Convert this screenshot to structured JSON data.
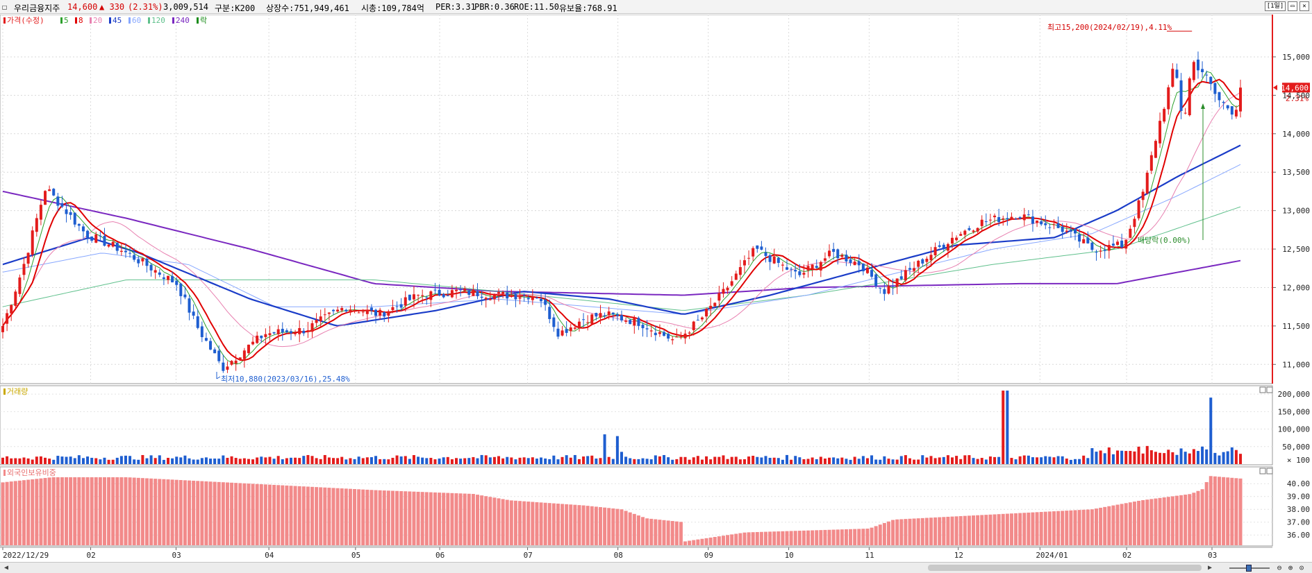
{
  "header": {
    "stock_name": "우리금융지주",
    "price": "14,600",
    "change": "▲ 330",
    "change_pct": "(2.31%)",
    "volume": "3,009,514",
    "category": "구분:K200",
    "shares": "상장수:751,949,461",
    "market_cap": "시총:109,784억",
    "per": "PER:3.31",
    "pbr": "PBR:0.36",
    "roe": "ROE:11.50",
    "reserve": "유보율:768.91",
    "period_button": "[1일]"
  },
  "legend": {
    "price_label": "가격(수정)",
    "ma_items": [
      {
        "label": "5",
        "color": "#2ca02c"
      },
      {
        "label": "8",
        "color": "#e00000"
      },
      {
        "label": "20",
        "color": "#e880b0"
      },
      {
        "label": "45",
        "color": "#1a3cc8"
      },
      {
        "label": "60",
        "color": "#88a8ff"
      },
      {
        "label": "120",
        "color": "#5fc08c"
      },
      {
        "label": "240",
        "color": "#7a28c0"
      }
    ],
    "ex_label": "락",
    "volume_label": "거래량",
    "foreign_label": "외국인보유비중"
  },
  "annotations": {
    "high_label": "최고15,200(2024/02/19),4.11%",
    "low_label": "최저10,880(2023/03/16),25.48%",
    "dividend_label": "배당락(0.00%)",
    "current_price": "14,600",
    "current_pct": "2.31%"
  },
  "colors": {
    "up": "#e31c1c",
    "down": "#1e5ed0",
    "foreign_bar": "#f28a8a",
    "price_tag": "#e31c1c"
  },
  "chart_data": [
    {
      "type": "candlestick",
      "title": "",
      "x_ticks": [
        "2022/12/29",
        "02",
        "03",
        "04",
        "05",
        "06",
        "07",
        "08",
        "09",
        "10",
        "11",
        "12",
        "2024/01",
        "02",
        "03"
      ],
      "y_ticks": [
        "11,000",
        "11,500",
        "12,000",
        "12,500",
        "13,000",
        "13,500",
        "14,000",
        "14,500",
        "15,000"
      ],
      "ylim": [
        10750,
        15550
      ],
      "anchor_closes": [
        [
          "2022/12/29",
          11500
        ],
        [
          "2023/01/05",
          12250
        ],
        [
          "2023/01/13",
          13300
        ],
        [
          "2023/01/27",
          12700
        ],
        [
          "2023/02/08",
          12500
        ],
        [
          "2023/02/17",
          12300
        ],
        [
          "2023/02/28",
          12050
        ],
        [
          "2023/03/07",
          11500
        ],
        [
          "2023/03/16",
          10950
        ],
        [
          "2023/03/24",
          11200
        ],
        [
          "2023/03/31",
          11400
        ],
        [
          "2023/04/14",
          11450
        ],
        [
          "2023/04/28",
          11750
        ],
        [
          "2023/05/10",
          11650
        ],
        [
          "2023/05/24",
          11900
        ],
        [
          "2023/06/07",
          11950
        ],
        [
          "2023/06/21",
          11900
        ],
        [
          "2023/07/05",
          11900
        ],
        [
          "2023/07/12",
          11400
        ],
        [
          "2023/07/21",
          11600
        ],
        [
          "2023/07/28",
          11650
        ],
        [
          "2023/08/09",
          11550
        ],
        [
          "2023/08/22",
          11300
        ],
        [
          "2023/08/31",
          11600
        ],
        [
          "2023/09/08",
          11950
        ],
        [
          "2023/09/19",
          12500
        ],
        [
          "2023/10/04",
          12150
        ],
        [
          "2023/10/16",
          12450
        ],
        [
          "2023/10/26",
          12300
        ],
        [
          "2023/11/03",
          11950
        ],
        [
          "2023/11/13",
          12250
        ],
        [
          "2023/11/27",
          12650
        ],
        [
          "2023/12/07",
          12850
        ],
        [
          "2023/12/20",
          12950
        ],
        [
          "2024/01/05",
          12750
        ],
        [
          "2024/01/15",
          12500
        ],
        [
          "2024/01/26",
          12550
        ],
        [
          "2024/02/02",
          13250
        ],
        [
          "2024/02/07",
          14050
        ],
        [
          "2024/02/13",
          14900
        ],
        [
          "2024/02/16",
          14100
        ],
        [
          "2024/02/19",
          14950
        ],
        [
          "2024/02/23",
          14800
        ],
        [
          "2024/02/28",
          14450
        ],
        [
          "2024/03/05",
          14270
        ],
        [
          "2024/03/07",
          14600
        ]
      ],
      "moving_averages": {
        "ma45": [
          [
            0,
            12300
          ],
          [
            0.07,
            12650
          ],
          [
            0.11,
            12450
          ],
          [
            0.2,
            11850
          ],
          [
            0.27,
            11500
          ],
          [
            0.35,
            11700
          ],
          [
            0.42,
            11950
          ],
          [
            0.49,
            11850
          ],
          [
            0.55,
            11650
          ],
          [
            0.62,
            11900
          ],
          [
            0.7,
            12250
          ],
          [
            0.77,
            12550
          ],
          [
            0.85,
            12650
          ],
          [
            0.9,
            13000
          ],
          [
            0.95,
            13450
          ],
          [
            1.0,
            13850
          ]
        ],
        "ma240": [
          [
            0,
            13250
          ],
          [
            0.1,
            12900
          ],
          [
            0.2,
            12500
          ],
          [
            0.3,
            12050
          ],
          [
            0.4,
            11950
          ],
          [
            0.55,
            11900
          ],
          [
            0.65,
            12000
          ],
          [
            0.82,
            12050
          ],
          [
            0.9,
            12050
          ],
          [
            1.0,
            12350
          ]
        ],
        "ma120": [
          [
            0,
            11750
          ],
          [
            0.1,
            12100
          ],
          [
            0.2,
            12100
          ],
          [
            0.3,
            12100
          ],
          [
            0.4,
            11950
          ],
          [
            0.55,
            11700
          ],
          [
            0.65,
            11900
          ],
          [
            0.8,
            12300
          ],
          [
            0.9,
            12500
          ],
          [
            1.0,
            13050
          ]
        ],
        "ma60": [
          [
            0,
            12200
          ],
          [
            0.08,
            12450
          ],
          [
            0.15,
            12300
          ],
          [
            0.22,
            11750
          ],
          [
            0.3,
            11750
          ],
          [
            0.4,
            11850
          ],
          [
            0.55,
            11650
          ],
          [
            0.65,
            11900
          ],
          [
            0.8,
            12500
          ],
          [
            0.88,
            12700
          ],
          [
            0.95,
            13200
          ],
          [
            1.0,
            13600
          ]
        ]
      }
    },
    {
      "type": "bar",
      "title": "거래량",
      "y_ticks": [
        "200,000",
        "150,000",
        "100,000",
        "50,000",
        "× 100"
      ],
      "ylim": [
        0,
        220000
      ],
      "spikes": [
        [
          0.485,
          85000
        ],
        [
          0.495,
          80000
        ],
        [
          0.5,
          35000
        ],
        [
          0.81,
          210000
        ],
        [
          0.976,
          190000
        ],
        [
          0.97,
          50000
        ]
      ]
    },
    {
      "type": "bar",
      "title": "외국인보유비중",
      "y_ticks": [
        "40.00",
        "39.00",
        "38.00",
        "37.00",
        "36.00"
      ],
      "ylim": [
        35.2,
        41.2
      ],
      "values_by_position": [
        [
          0,
          40.1
        ],
        [
          0.04,
          40.5
        ],
        [
          0.1,
          40.5
        ],
        [
          0.14,
          40.3
        ],
        [
          0.2,
          40.0
        ],
        [
          0.3,
          39.5
        ],
        [
          0.38,
          39.2
        ],
        [
          0.41,
          38.7
        ],
        [
          0.47,
          38.3
        ],
        [
          0.5,
          38.0
        ],
        [
          0.52,
          37.3
        ],
        [
          0.55,
          37.0
        ],
        [
          0.551,
          35.5
        ],
        [
          0.6,
          36.2
        ],
        [
          0.7,
          36.5
        ],
        [
          0.72,
          37.2
        ],
        [
          0.8,
          37.6
        ],
        [
          0.88,
          38.0
        ],
        [
          0.92,
          38.7
        ],
        [
          0.96,
          39.2
        ],
        [
          0.97,
          39.6
        ],
        [
          0.975,
          40.6
        ],
        [
          1.0,
          40.4
        ]
      ]
    }
  ],
  "date_axis": [
    "2022/12/29",
    "02",
    "03",
    "04",
    "05",
    "06",
    "07",
    "08",
    "09",
    "10",
    "11",
    "12",
    "2024/01",
    "02",
    "03"
  ]
}
